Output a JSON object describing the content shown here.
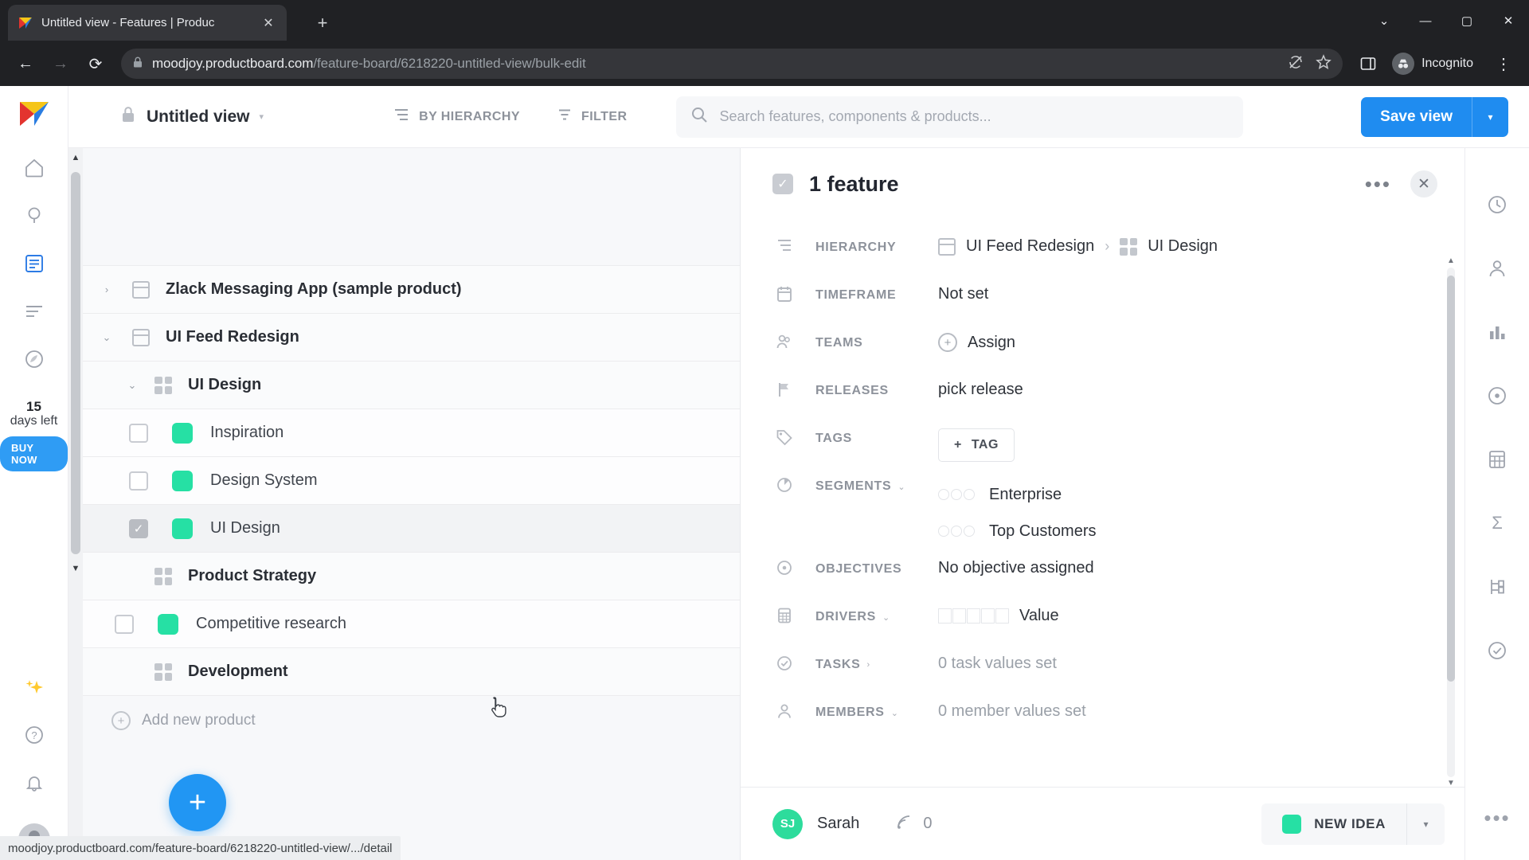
{
  "browser": {
    "tab_title": "Untitled view - Features | Produc",
    "tab_close_glyph": "✕",
    "new_tab_glyph": "+",
    "back_glyph": "←",
    "forward_glyph": "→",
    "reload_glyph": "⟳",
    "url_host": "moodjoy.productboard.com",
    "url_path": "/feature-board/6218220-untitled-view/bulk-edit",
    "profile_label": "Incognito",
    "minimize_glyph": "—",
    "maximize_glyph": "▢",
    "close_glyph": "✕",
    "chevron_down_glyph": "⌄",
    "status_text": "moodjoy.productboard.com/feature-board/6218220-untitled-view/.../detail"
  },
  "appbar": {
    "view_name": "Untitled view",
    "caret": "▾",
    "by_hierarchy": "BY HIERARCHY",
    "filter": "FILTER",
    "search_placeholder": "Search features, components & products...",
    "search_value": "",
    "save_view": "Save view",
    "save_view_caret": "▾"
  },
  "rail": {
    "trial_days": "15",
    "trial_label": "days left",
    "buy_now": "BUY NOW"
  },
  "board": {
    "rows": [
      {
        "type": "product",
        "label": "Zlack Messaging App (sample product)",
        "twisty": "›",
        "checkbox": null,
        "swatch": false
      },
      {
        "type": "product",
        "label": "UI Feed Redesign",
        "twisty": "⌄",
        "checkbox": null,
        "swatch": false
      },
      {
        "type": "component",
        "label": "UI Design",
        "twisty": "⌄",
        "checkbox": null,
        "swatch": false
      },
      {
        "type": "feature",
        "label": "Inspiration",
        "twisty": "",
        "checkbox": "unchecked",
        "swatch": true
      },
      {
        "type": "feature",
        "label": "Design System",
        "twisty": "",
        "checkbox": "unchecked",
        "swatch": true
      },
      {
        "type": "feature",
        "label": "UI Design",
        "twisty": "",
        "checkbox": "checked",
        "swatch": true
      },
      {
        "type": "component",
        "label": "Product Strategy",
        "twisty": "",
        "checkbox": null,
        "swatch": false
      },
      {
        "type": "feature",
        "label": "Competitive research",
        "twisty": "",
        "checkbox": "unchecked",
        "swatch": true
      },
      {
        "type": "component",
        "label": "Development",
        "twisty": "",
        "checkbox": null,
        "swatch": false
      }
    ],
    "add_new_product": "Add new product",
    "fab_glyph": "+",
    "swatch_color": "#26e0a4"
  },
  "panel": {
    "title": "1 feature",
    "checkbox_glyph": "✓",
    "more_glyph": "•••",
    "close_glyph": "✕",
    "fields": {
      "hierarchy_label": "HIERARCHY",
      "hierarchy_product": "UI Feed Redesign",
      "hierarchy_sep": "›",
      "hierarchy_component": "UI Design",
      "timeframe_label": "TIMEFRAME",
      "timeframe_value": "Not set",
      "teams_label": "TEAMS",
      "teams_value": "Assign",
      "releases_label": "RELEASES",
      "releases_value": "pick release",
      "tags_label": "TAGS",
      "tags_button": "TAG",
      "tags_plus": "+",
      "segments_label": "SEGMENTS",
      "segments_chevron": "⌄",
      "segments": [
        "Enterprise",
        "Top Customers"
      ],
      "objectives_label": "OBJECTIVES",
      "objectives_value": "No objective assigned",
      "drivers_label": "DRIVERS",
      "drivers_chevron": "⌄",
      "drivers_value": "Value",
      "tasks_label": "TASKS",
      "tasks_chevron": "›",
      "tasks_value": "0 task values set",
      "members_label": "MEMBERS",
      "members_chevron": "⌄",
      "members_value": "0 member values set"
    },
    "footer": {
      "owner_initials": "SJ",
      "owner_name": "Sarah",
      "insight_count": "0",
      "new_idea": "NEW IDEA",
      "new_idea_caret": "▾",
      "more_glyph": "•••"
    }
  }
}
